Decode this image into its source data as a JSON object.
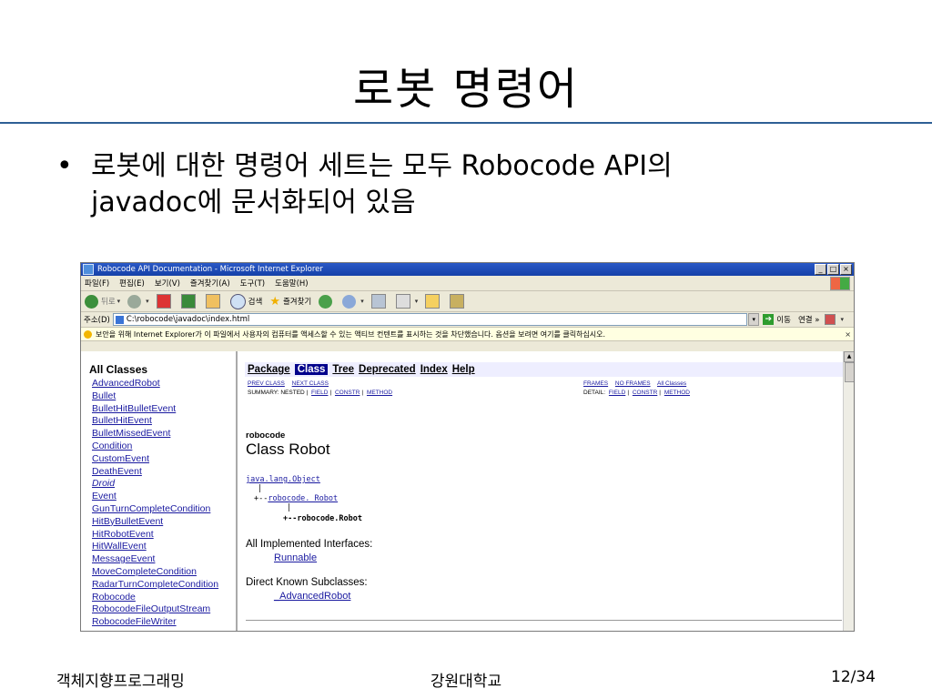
{
  "slide": {
    "title": "로봇 명령어",
    "bullet_marker": "•",
    "bullet_line1": "로봇에 대한 명령어 세트는 모두 Robocode API의",
    "bullet_line2": "javadoc에 문서화되어 있음",
    "footer_left": "객체지향프로그래밍",
    "footer_center": "강원대학교",
    "footer_right": "12/34"
  },
  "browser": {
    "window_title": "Robocode API Documentation - Microsoft Internet Explorer",
    "window_buttons": [
      "_",
      "□",
      "×"
    ],
    "menu": [
      "파일(F)",
      "편집(E)",
      "보기(V)",
      "즐겨찾기(A)",
      "도구(T)",
      "도움말(H)"
    ],
    "toolbar": {
      "back": "뒤로",
      "search": "검색",
      "favorites": "즐겨찾기"
    },
    "address": {
      "label": "주소(D)",
      "url": "C:\\robocode\\javadoc\\index.html",
      "go": "이동",
      "links": "연결 »"
    },
    "infobar": "보안을 위해 Internet Explorer가 이 파일에서 사용자의 컴퓨터를 액세스할 수 있는 액티브 컨텐트를 표시하는 것을 차단했습니다. 옵션을 보려면 여기를 클릭하십시오.",
    "infobar_close": "×"
  },
  "javadoc": {
    "all_classes_heading": "All Classes",
    "classes": [
      {
        "name": "AdvancedRobot",
        "italic": false
      },
      {
        "name": "Bullet",
        "italic": false
      },
      {
        "name": "BulletHitBulletEvent",
        "italic": false
      },
      {
        "name": "BulletHitEvent",
        "italic": false
      },
      {
        "name": "BulletMissedEvent",
        "italic": false
      },
      {
        "name": "Condition",
        "italic": false
      },
      {
        "name": "CustomEvent",
        "italic": false
      },
      {
        "name": "DeathEvent",
        "italic": false
      },
      {
        "name": "Droid",
        "italic": true
      },
      {
        "name": "Event",
        "italic": false
      },
      {
        "name": "GunTurnCompleteCondition",
        "italic": false
      },
      {
        "name": "HitByBulletEvent",
        "italic": false
      },
      {
        "name": "HitRobotEvent",
        "italic": false
      },
      {
        "name": "HitWallEvent",
        "italic": false
      },
      {
        "name": "MessageEvent",
        "italic": false
      },
      {
        "name": "MoveCompleteCondition",
        "italic": false
      },
      {
        "name": "RadarTurnCompleteCondition",
        "italic": false
      },
      {
        "name": "Robocode",
        "italic": false
      },
      {
        "name": "RobocodeFileOutputStream",
        "italic": false
      },
      {
        "name": "RobocodeFileWriter",
        "italic": false
      }
    ],
    "nav": [
      "Package",
      "Class",
      "Tree",
      "Deprecated",
      "Index",
      "Help"
    ],
    "nav_active": "Class",
    "prev_class": "PREV CLASS",
    "next_class": "NEXT CLASS",
    "summary_label": "SUMMARY: NESTED |",
    "summary_field": "FIELD",
    "summary_constr": "CONSTR",
    "summary_method": "METHOD",
    "frames": "FRAMES",
    "no_frames": "NO FRAMES",
    "all_classes": "All Classes",
    "detail_label": "DETAIL:",
    "detail_field": "FIELD",
    "detail_constr": "CONSTR",
    "detail_method": "METHOD",
    "sep": "|",
    "package_name": "robocode",
    "class_title": "Class Robot",
    "hier_object": "java.lang.Object",
    "hier_pipe": "|",
    "hier_mid_prefix": "+--",
    "hier_mid": "robocode._Robot",
    "hier_leaf": "+--robocode.Robot",
    "impl_heading": "All Implemented Interfaces:",
    "impl_link": "Runnable",
    "subclasses_heading": "Direct Known Subclasses:",
    "subclass_link": "_AdvancedRobot"
  },
  "colors": {
    "title_rule": "#2e5f95",
    "link": "#1a1aa0",
    "nav_active_bg": "#00008b",
    "navbar_bg": "#eeeeff",
    "titlebar": "#2a58c6"
  }
}
